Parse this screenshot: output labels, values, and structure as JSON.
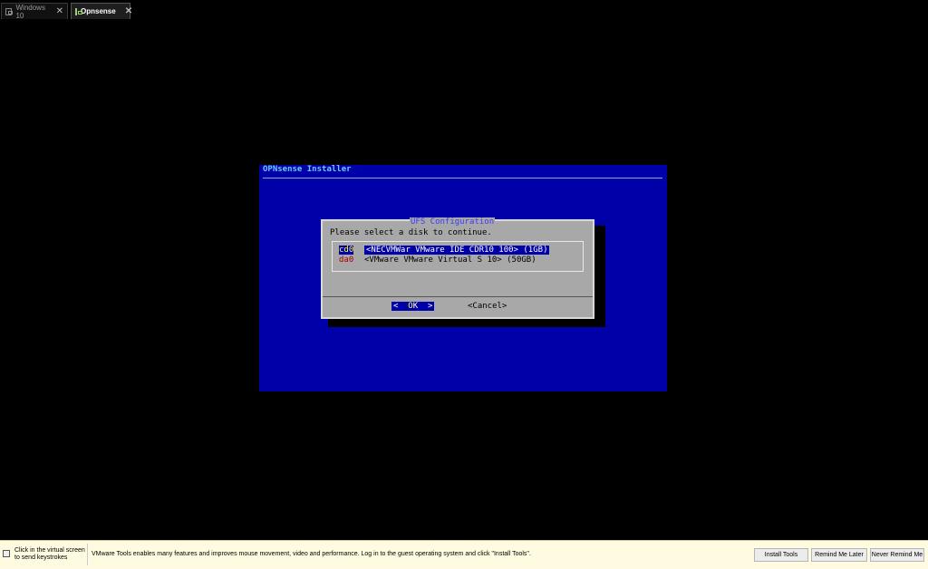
{
  "tabs": [
    {
      "label": "Windows 10",
      "active": false
    },
    {
      "label": "Opnsense",
      "active": true
    }
  ],
  "console": {
    "title": "OPNsense Installer"
  },
  "dialog": {
    "title": "UFS Configuration",
    "prompt": "Please select a disk to continue.",
    "disks": [
      {
        "tag": "cd0",
        "description": "<NECVMWar VMware IDE CDR10 100> (1GB)",
        "selected": true
      },
      {
        "tag": "da0",
        "description": "<VMware VMware Virtual S 10> (50GB)",
        "selected": false
      }
    ],
    "ok_button": {
      "left": "<  ",
      "hotkey": "O",
      "rest": "K  >"
    },
    "cancel_button": "<Cancel>"
  },
  "statusbar": {
    "hint": "Click in the virtual screen to send keystrokes",
    "message": "VMware Tools enables many features and improves mouse movement, video and performance. Log in to the guest operating system and click \"Install Tools\".",
    "buttons": {
      "install": "Install Tools",
      "remind_later": "Remind Me Later",
      "never_remind": "Never Remind Me"
    }
  },
  "colors": {
    "console_bg": "#0000a8",
    "dialog_bg": "#a8a8a8",
    "highlight": "#ffff33",
    "status_bg": "#fffbe0"
  }
}
